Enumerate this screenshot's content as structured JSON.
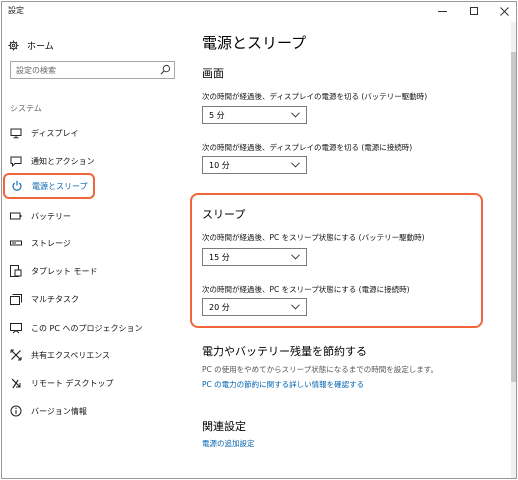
{
  "window": {
    "title": "設定"
  },
  "sidebar": {
    "home_label": "ホーム",
    "search_placeholder": "設定の検索",
    "section_label": "システム",
    "items": [
      {
        "label": "ディスプレイ",
        "icon": "display-icon"
      },
      {
        "label": "通知とアクション",
        "icon": "notification-icon"
      },
      {
        "label": "電源とスリープ",
        "icon": "power-icon",
        "active": true
      },
      {
        "label": "バッテリー",
        "icon": "battery-icon"
      },
      {
        "label": "ストレージ",
        "icon": "storage-icon"
      },
      {
        "label": "タブレット モード",
        "icon": "tablet-mode-icon"
      },
      {
        "label": "マルチタスク",
        "icon": "multitasking-icon"
      },
      {
        "label": "この PC へのプロジェクション",
        "icon": "projection-icon"
      },
      {
        "label": "共有エクスペリエンス",
        "icon": "shared-experience-icon"
      },
      {
        "label": "リモート デスクトップ",
        "icon": "remote-desktop-icon"
      },
      {
        "label": "バージョン情報",
        "icon": "info-icon"
      }
    ]
  },
  "main": {
    "title": "電源とスリープ",
    "screen": {
      "heading": "画面",
      "battery_label": "次の時間が経過後、ディスプレイの電源を切る (バッテリー駆動時)",
      "battery_value": "5 分",
      "plugged_label": "次の時間が経過後、ディスプレイの電源を切る (電源に接続時)",
      "plugged_value": "10 分"
    },
    "sleep": {
      "heading": "スリープ",
      "battery_label": "次の時間が経過後、PC をスリープ状態にする (バッテリー駆動時)",
      "battery_value": "15 分",
      "plugged_label": "次の時間が経過後、PC をスリープ状態にする (電源に接続時)",
      "plugged_value": "20 分"
    },
    "save_power": {
      "heading": "電力やバッテリー残量を節約する",
      "description": "PC の使用をやめてからスリープ状態になるまでの時間を設定します。",
      "link": "PC の電力の節約に関する詳しい情報を確認する"
    },
    "related": {
      "heading": "関連設定",
      "link": "電源の追加設定"
    }
  },
  "colors": {
    "accent": "#0063b1",
    "highlight_frame": "#f0663a"
  }
}
